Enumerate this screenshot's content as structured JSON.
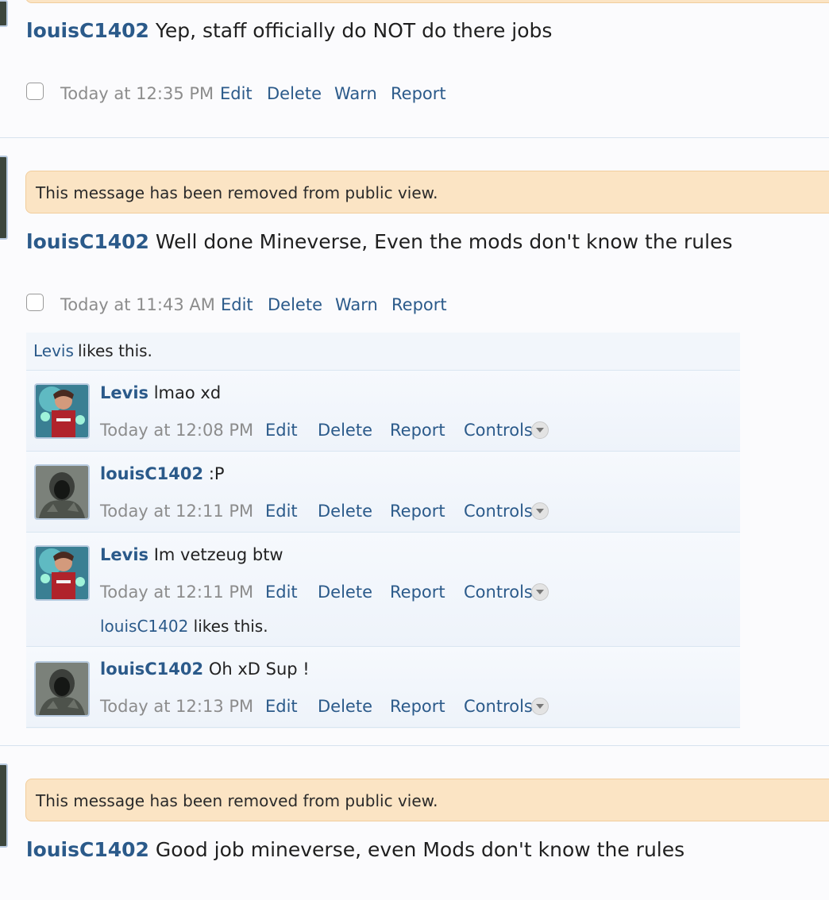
{
  "posts": [
    {
      "author": "louisC1402",
      "text": "Yep, staff officially do NOT do there jobs",
      "time": "Today at 12:35 PM",
      "actions": [
        "Edit",
        "Delete",
        "Warn",
        "Report"
      ]
    },
    {
      "notice": "This message has been removed from public view.",
      "author": "louisC1402",
      "text": "Well done Mineverse, Even the mods don't know the rules",
      "time": "Today at 11:43 AM",
      "actions": [
        "Edit",
        "Delete",
        "Warn",
        "Report"
      ],
      "likes": {
        "user": "Levis",
        "suffix": "likes this."
      },
      "comments": [
        {
          "author": "Levis",
          "text": "lmao xd",
          "time": "Today at 12:08 PM",
          "actions": [
            "Edit",
            "Delete",
            "Report",
            "Controls"
          ]
        },
        {
          "author": "louisC1402",
          "text": ":P",
          "time": "Today at 12:11 PM",
          "actions": [
            "Edit",
            "Delete",
            "Report",
            "Controls"
          ]
        },
        {
          "author": "Levis",
          "text": "Im vetzeug btw",
          "time": "Today at 12:11 PM",
          "actions": [
            "Edit",
            "Delete",
            "Report",
            "Controls"
          ],
          "likes": {
            "user": "louisC1402",
            "suffix": "likes this."
          }
        },
        {
          "author": "louisC1402",
          "text": "Oh xD Sup !",
          "time": "Today at 12:13 PM",
          "actions": [
            "Edit",
            "Delete",
            "Report",
            "Controls"
          ]
        }
      ]
    },
    {
      "notice": "This message has been removed from public view.",
      "author": "louisC1402",
      "text": "Good job mineverse, even Mods don't know the rules"
    }
  ],
  "colors": {
    "link": "#2b5a8a",
    "notice_bg": "#fbe4c4",
    "notice_border": "#f1cd9c",
    "meta": "#8c8c8c"
  },
  "icons": {
    "controls": "chevron-down-icon",
    "avatar_levis": "avatar",
    "avatar_louis": "avatar"
  }
}
